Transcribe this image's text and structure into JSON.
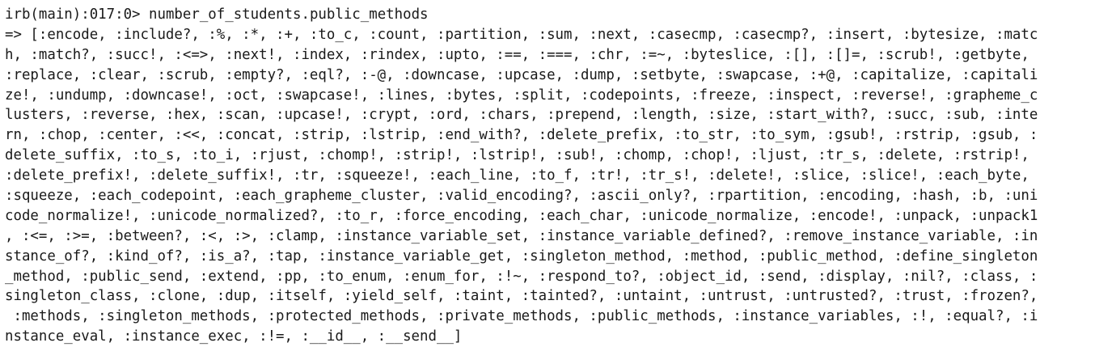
{
  "terminal": {
    "prompt": "irb(main):017:0>",
    "command": "number_of_students.public_methods",
    "output_lines": [
      "=> [:encode, :include?, :%, :*, :+, :to_c, :count, :partition, :sum, :next, :casecmp, :casecmp?, :insert, :bytesize, :matc",
      "h, :match?, :succ!, :<=>, :next!, :index, :rindex, :upto, :==, :===, :chr, :=~, :byteslice, :[], :[]=, :scrub!, :getbyte,",
      ":replace, :clear, :scrub, :empty?, :eql?, :-@, :downcase, :upcase, :dump, :setbyte, :swapcase, :+@, :capitalize, :capitali",
      "ze!, :undump, :downcase!, :oct, :swapcase!, :lines, :bytes, :split, :codepoints, :freeze, :inspect, :reverse!, :grapheme_c",
      "lusters, :reverse, :hex, :scan, :upcase!, :crypt, :ord, :chars, :prepend, :length, :size, :start_with?, :succ, :sub, :inte",
      "rn, :chop, :center, :<<, :concat, :strip, :lstrip, :end_with?, :delete_prefix, :to_str, :to_sym, :gsub!, :rstrip, :gsub, :",
      "delete_suffix, :to_s, :to_i, :rjust, :chomp!, :strip!, :lstrip!, :sub!, :chomp, :chop!, :ljust, :tr_s, :delete, :rstrip!,",
      ":delete_prefix!, :delete_suffix!, :tr, :squeeze!, :each_line, :to_f, :tr!, :tr_s!, :delete!, :slice, :slice!, :each_byte,",
      ":squeeze, :each_codepoint, :each_grapheme_cluster, :valid_encoding?, :ascii_only?, :rpartition, :encoding, :hash, :b, :uni",
      "code_normalize!, :unicode_normalized?, :to_r, :force_encoding, :each_char, :unicode_normalize, :encode!, :unpack, :unpack1",
      ", :<=, :>=, :between?, :<, :>, :clamp, :instance_variable_set, :instance_variable_defined?, :remove_instance_variable, :in",
      "stance_of?, :kind_of?, :is_a?, :tap, :instance_variable_get, :singleton_method, :method, :public_method, :define_singleton",
      "_method, :public_send, :extend, :pp, :to_enum, :enum_for, :!~, :respond_to?, :object_id, :send, :display, :nil?, :class, :",
      "singleton_class, :clone, :dup, :itself, :yield_self, :taint, :tainted?, :untaint, :untrust, :untrusted?, :trust, :frozen?,",
      " :methods, :singleton_methods, :protected_methods, :private_methods, :public_methods, :instance_variables, :!, :equal?, :i",
      "nstance_eval, :instance_exec, :!=, :__id__, :__send__]"
    ]
  }
}
